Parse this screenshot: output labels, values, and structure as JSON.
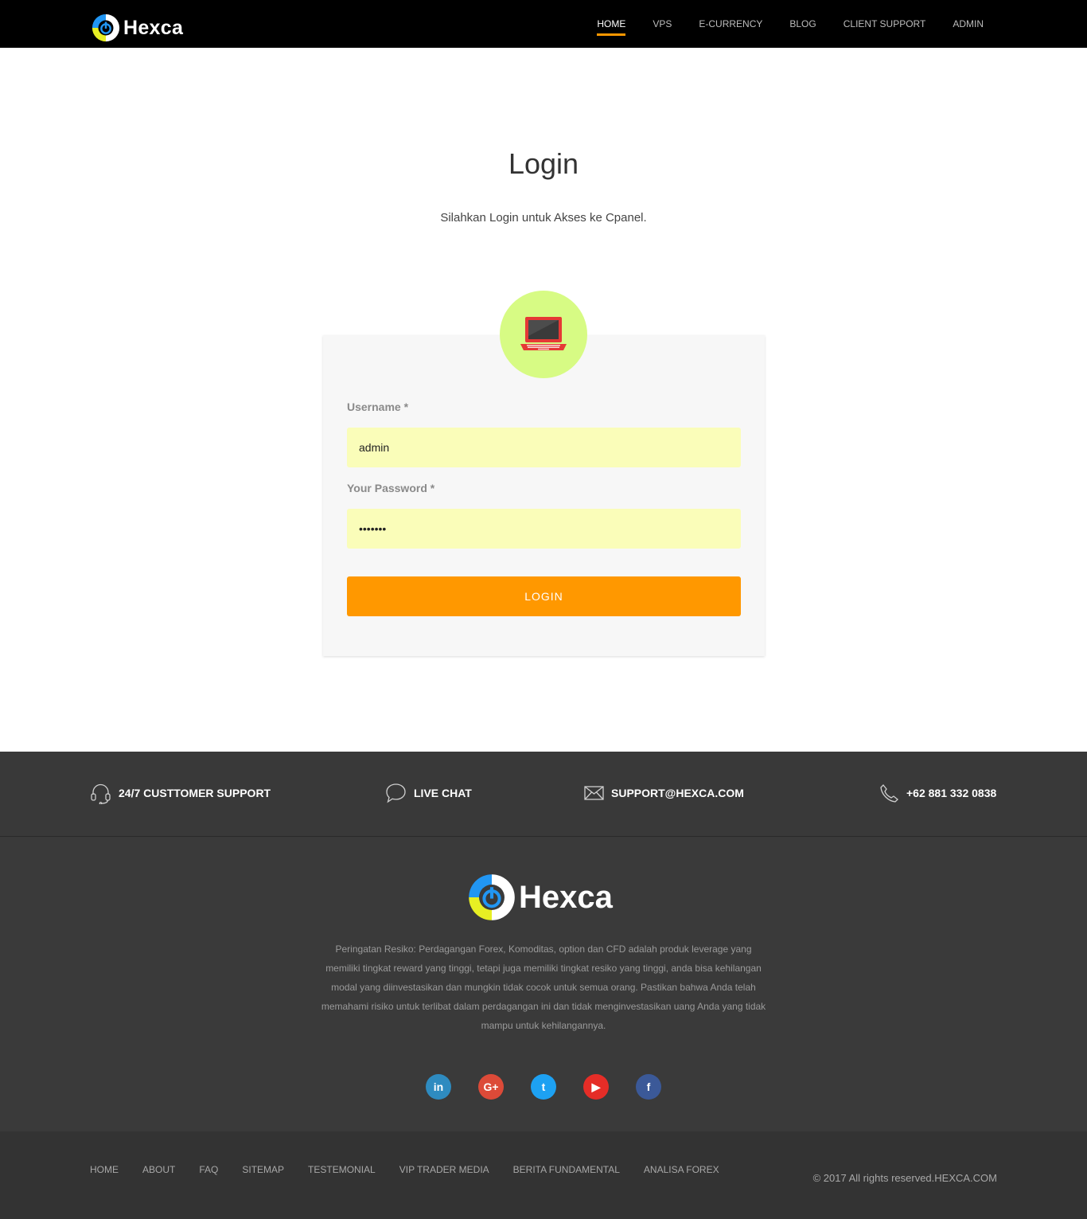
{
  "header": {
    "brand": "Hexca",
    "nav": [
      {
        "label": "HOME",
        "active": true
      },
      {
        "label": "VPS"
      },
      {
        "label": "E-CURRENCY"
      },
      {
        "label": "BLOG"
      },
      {
        "label": "CLIENT SUPPORT"
      },
      {
        "label": "ADMIN"
      }
    ]
  },
  "main": {
    "title": "Login",
    "subtitle": "Silahkan Login untuk Akses ke Cpanel.",
    "avatar_icon": "laptop-icon",
    "form": {
      "username_label": "Username *",
      "username_value": "admin",
      "password_label": "Your Password *",
      "password_value": "•••••••",
      "submit_label": "LOGIN"
    }
  },
  "contact_strip": {
    "support": {
      "icon": "headset-icon",
      "label": "24/7 CUSTTOMER SUPPORT"
    },
    "chat": {
      "icon": "chat-bubble-icon",
      "label": "LIVE CHAT"
    },
    "email": {
      "icon": "envelope-icon",
      "label": "SUPPORT@HEXCA.COM"
    },
    "phone": {
      "icon": "phone-icon",
      "label": "+62 881 332 0838"
    }
  },
  "footer": {
    "brand": "Hexca",
    "disclaimer": "Peringatan Resiko: Perdagangan Forex, Komoditas, option dan CFD adalah produk leverage yang memiliki tingkat reward yang tinggi, tetapi juga memiliki tingkat resiko yang tinggi, anda bisa kehilangan modal yang diinvestasikan dan mungkin tidak cocok untuk semua orang. Pastikan bahwa Anda telah memahami risiko untuk terlibat dalam perdagangan ini dan tidak menginvestasikan uang Anda yang tidak mampu untuk kehilangannya.",
    "socials": [
      {
        "name": "linkedin",
        "glyph": "in",
        "color": "#2e8bc0"
      },
      {
        "name": "google-plus",
        "glyph": "G+",
        "color": "#dc4a38"
      },
      {
        "name": "twitter",
        "glyph": "t",
        "color": "#1da1f2"
      },
      {
        "name": "youtube",
        "glyph": "▶",
        "color": "#e52d27"
      },
      {
        "name": "facebook",
        "glyph": "f",
        "color": "#3b5998"
      }
    ],
    "links": [
      "HOME",
      "ABOUT",
      "FAQ",
      "SITEMAP",
      "TESTEMONIAL",
      "VIP TRADER MEDIA",
      "BERITA FUNDAMENTAL",
      "ANALISA FOREX"
    ],
    "copyright": "© 2017 All rights reserved.HEXCA.COM"
  },
  "colors": {
    "accent": "#ff9800",
    "input_bg": "#fafdb9",
    "avatar_bg": "#d7fb84"
  }
}
